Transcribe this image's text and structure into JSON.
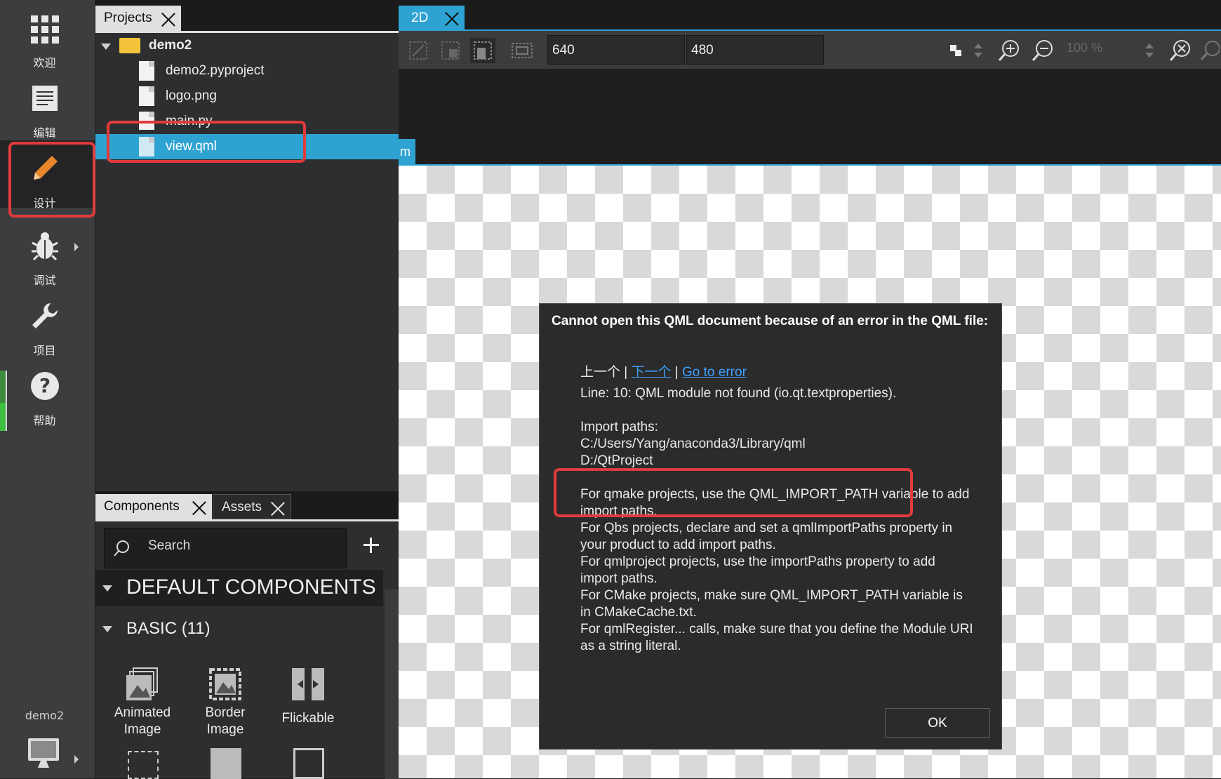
{
  "mode_bar": {
    "items": [
      {
        "label": "欢迎",
        "icon": "grid-icon"
      },
      {
        "label": "编辑",
        "icon": "document-icon"
      },
      {
        "label": "设计",
        "icon": "pencil-icon"
      },
      {
        "label": "调试",
        "icon": "bug-icon"
      },
      {
        "label": "项目",
        "icon": "wrench-icon"
      },
      {
        "label": "帮助",
        "icon": "help-icon"
      }
    ],
    "active": "设计",
    "kit_label": "demo2"
  },
  "projects_panel": {
    "tab_label": "Projects",
    "tree": {
      "root": "demo2",
      "files": [
        "demo2.pyproject",
        "logo.png",
        "main.py",
        "view.qml"
      ],
      "selected": "view.qml"
    }
  },
  "components_panel": {
    "tabs": [
      "Components",
      "Assets"
    ],
    "search_placeholder": "Search",
    "section_default": "DEFAULT COMPONENTS",
    "section_basic": "BASIC (11)",
    "items": [
      {
        "line1": "Animated",
        "line2": "Image"
      },
      {
        "line1": "Border",
        "line2": "Image"
      },
      {
        "line1": "Flickable",
        "line2": ""
      }
    ]
  },
  "editor": {
    "tab_label": "2D",
    "width_value": "640",
    "height_value": "480",
    "zoom_value": "100 %",
    "root_tag": "m"
  },
  "dialog": {
    "title": "Cannot open this QML document because of an error in the QML file:",
    "nav_prev": "上一个",
    "nav_next": "下一个",
    "nav_goto": "Go to error",
    "nav_sep": " | ",
    "error_line": "Line: 10: QML module not found (io.qt.textproperties).",
    "import_label": "Import paths:",
    "import_path_1": "C:/Users/Yang/anaconda3/Library/qml",
    "import_path_2": "D:/QtProject",
    "hint_qmake": "For qmake projects, use the QML_IMPORT_PATH variable to add import paths.",
    "hint_qbs": "For Qbs projects, declare and set a qmlImportPaths property in your product to add import paths.",
    "hint_qmlproject": "For qmlproject projects, use the importPaths property to add import paths.",
    "hint_cmake": "For CMake projects, make sure QML_IMPORT_PATH variable is in CMakeCache.txt.",
    "hint_register": "For qmlRegister... calls, make sure that you define the Module URI as a string literal.",
    "ok_label": "OK"
  },
  "colors": {
    "accent": "#2ea3d2",
    "highlight_red": "#e23b3b",
    "link": "#3ea0ff"
  }
}
